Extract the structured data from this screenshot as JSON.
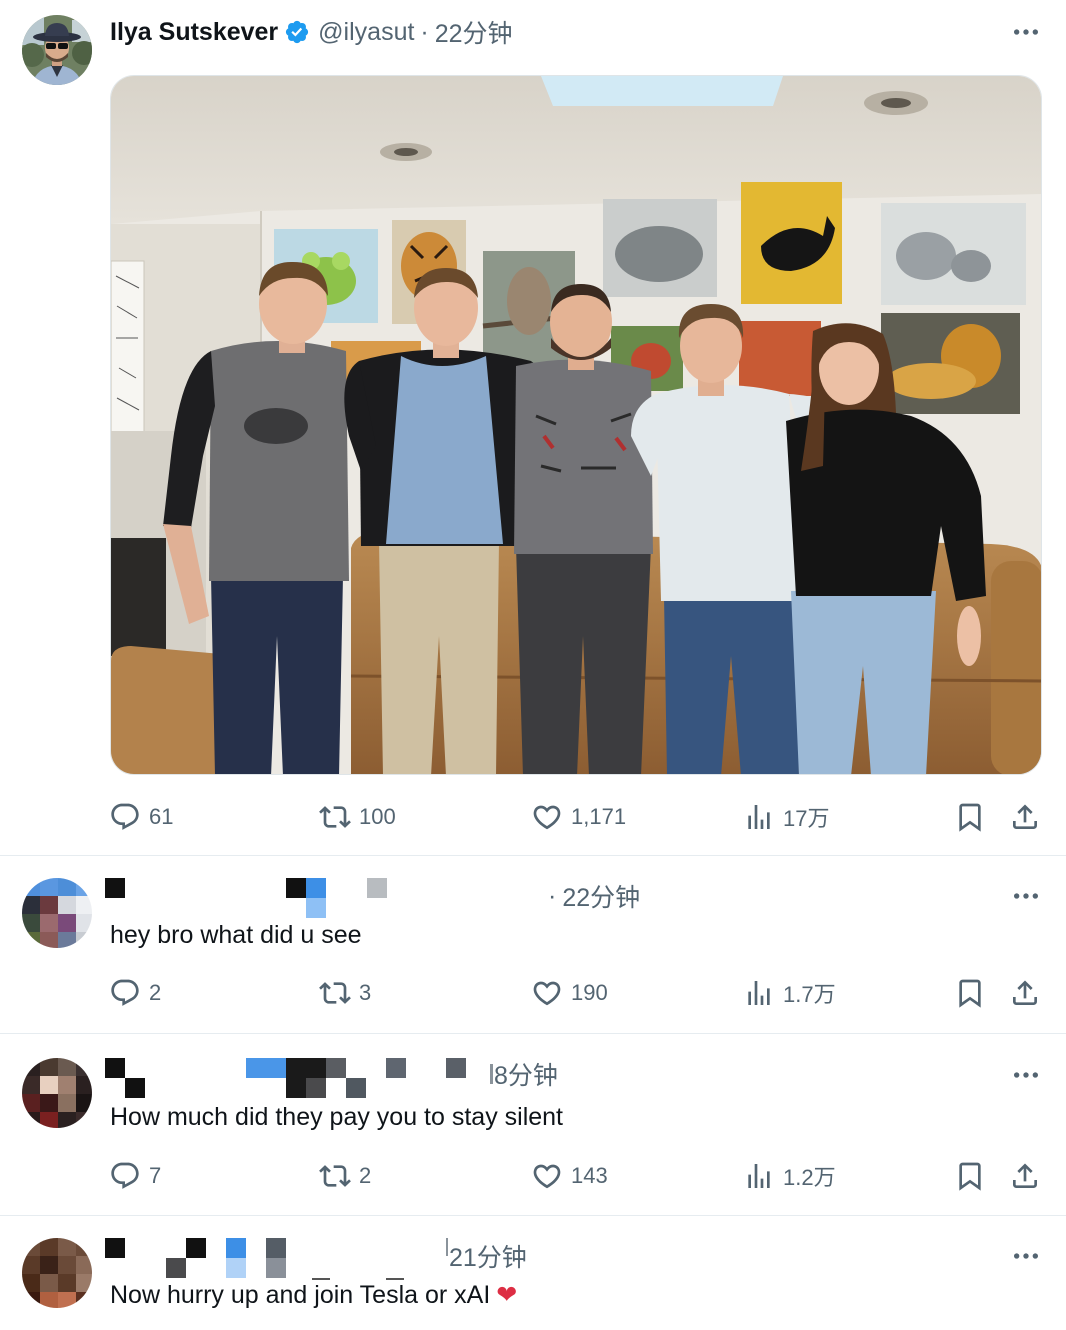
{
  "colors": {
    "text": "#0f1419",
    "secondary": "#536471",
    "verified": "#1d9bf0",
    "divider": "#e6ecf0",
    "heart": "#dd2e44"
  },
  "icons": {
    "reply": "reply-icon",
    "retweet": "retweet-icon",
    "like": "heart-icon",
    "views": "views-icon",
    "bookmark": "bookmark-icon",
    "share": "share-icon",
    "more": "more-icon",
    "verified": "verified-badge-icon"
  },
  "tweet": {
    "author": {
      "name": "Ilya Sutskever",
      "handle": "@ilyasut"
    },
    "separator": "·",
    "time": "22分钟",
    "stats": {
      "replies": "61",
      "retweets": "100",
      "likes": "1,171",
      "views": "17万"
    }
  },
  "replies": [
    {
      "separator": "·",
      "time": "22分钟",
      "text": "hey bro what did u see",
      "stats": {
        "replies": "2",
        "retweets": "3",
        "likes": "190",
        "views": "1.7万"
      }
    },
    {
      "time": "8分钟",
      "text": "How much did they pay you to stay silent",
      "stats": {
        "replies": "7",
        "retweets": "2",
        "likes": "143",
        "views": "1.2万"
      }
    },
    {
      "time": "21分钟",
      "text": "Now hurry up and join Tesla or xAI",
      "emoji": "❤"
    }
  ]
}
